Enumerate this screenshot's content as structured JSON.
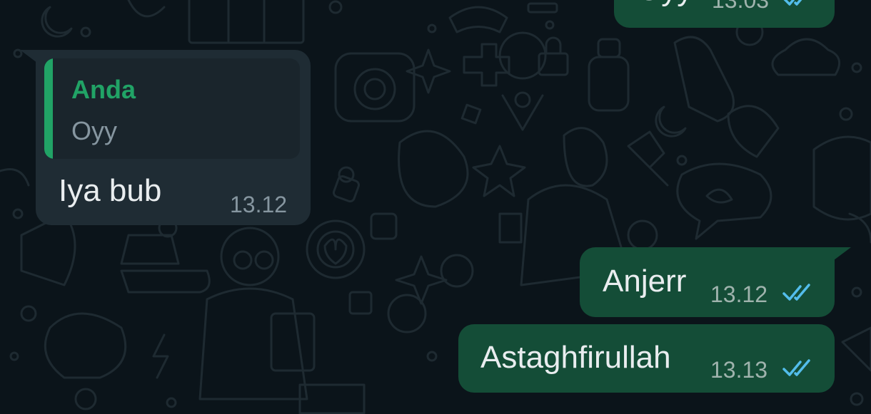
{
  "colors": {
    "background": "#0b141a",
    "incoming_bubble": "#1f2c34",
    "outgoing_bubble": "#144d37",
    "quote_accent": "#21a366",
    "read_ticks": "#53bdeb"
  },
  "messages": [
    {
      "direction": "outgoing",
      "text": "Oyy",
      "time": "13.03",
      "status_icon": "double-check-read-icon"
    },
    {
      "direction": "incoming",
      "reply_to": {
        "author": "Anda",
        "text": "Oyy"
      },
      "text": "Iya bub",
      "time": "13.12"
    },
    {
      "direction": "outgoing",
      "text": "Anjerr",
      "time": "13.12",
      "status_icon": "double-check-read-icon"
    },
    {
      "direction": "outgoing",
      "text": "Astaghfirullah",
      "time": "13.13",
      "status_icon": "double-check-read-icon"
    }
  ]
}
